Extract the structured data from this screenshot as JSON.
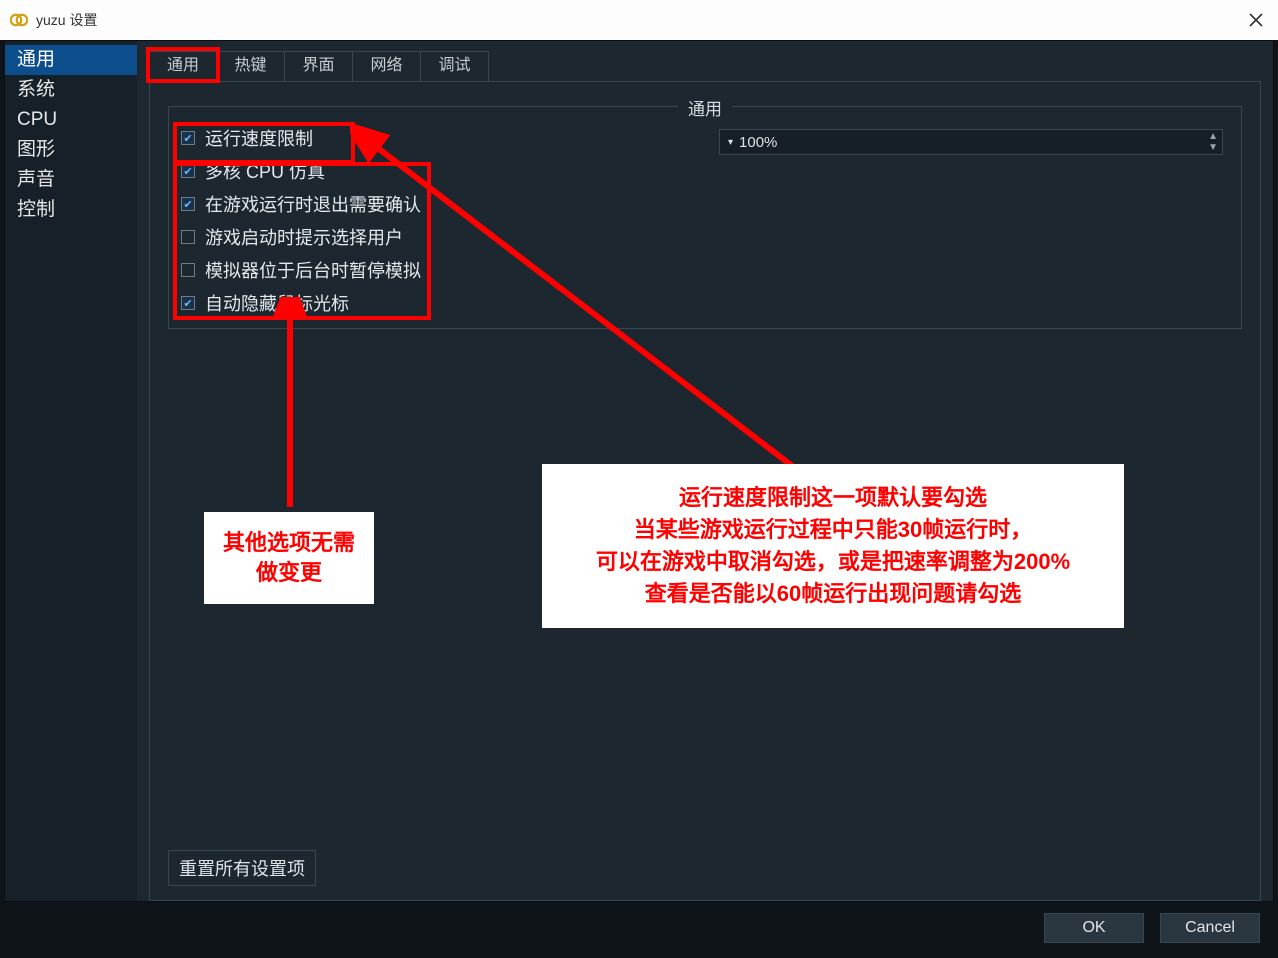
{
  "title": "yuzu 设置",
  "sidebar": {
    "items": [
      {
        "label": "通用",
        "active": true
      },
      {
        "label": "系统"
      },
      {
        "label": "CPU"
      },
      {
        "label": "图形"
      },
      {
        "label": "声音"
      },
      {
        "label": "控制"
      }
    ]
  },
  "tabs": [
    {
      "label": "通用",
      "highlight": true
    },
    {
      "label": "热键"
    },
    {
      "label": "界面"
    },
    {
      "label": "网络"
    },
    {
      "label": "调试"
    }
  ],
  "fieldset_label": "通用",
  "options": [
    {
      "label": "运行速度限制",
      "checked": true
    },
    {
      "label": "多核 CPU 仿真",
      "checked": true
    },
    {
      "label": "在游戏运行时退出需要确认",
      "checked": true
    },
    {
      "label": "游戏启动时提示选择用户",
      "checked": false
    },
    {
      "label": "模拟器位于后台时暂停模拟",
      "checked": false
    },
    {
      "label": "自动隐藏鼠标光标",
      "checked": true
    }
  ],
  "speed_value": "100%",
  "reset_label": "重置所有设置项",
  "footer": {
    "ok": "OK",
    "cancel": "Cancel"
  },
  "callout1": {
    "line1": "其他选项无需",
    "line2": "做变更"
  },
  "callout2": {
    "line1": "运行速度限制这一项默认要勾选",
    "line2": "当某些游戏运行过程中只能30帧运行时，",
    "line3": "可以在游戏中取消勾选，或是把速率调整为200%",
    "line4": "查看是否能以60帧运行出现问题请勾选"
  }
}
